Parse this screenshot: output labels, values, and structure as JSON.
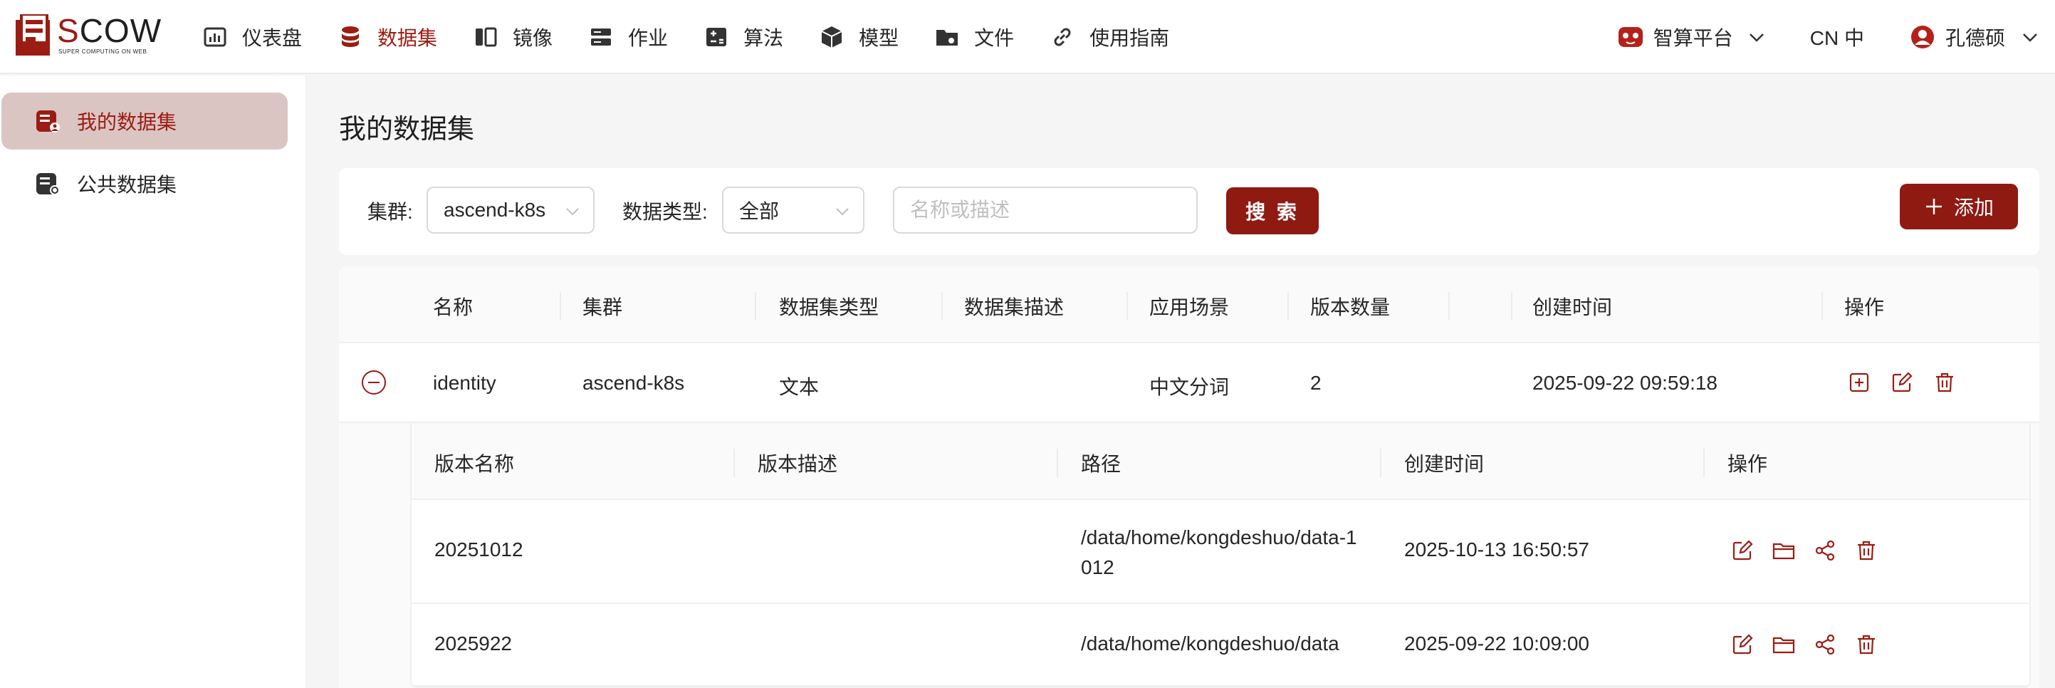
{
  "brand": {
    "name": "SCOW",
    "subtitle": "SUPER COMPUTING ON WEB",
    "accent": "#9b1c12"
  },
  "nav": [
    {
      "label": "仪表盘",
      "icon": "dashboard-icon"
    },
    {
      "label": "数据集",
      "icon": "database-icon",
      "active": true
    },
    {
      "label": "镜像",
      "icon": "image-icon"
    },
    {
      "label": "作业",
      "icon": "job-icon"
    },
    {
      "label": "算法",
      "icon": "algorithm-icon"
    },
    {
      "label": "模型",
      "icon": "model-cube-icon"
    },
    {
      "label": "文件",
      "icon": "folder-icon"
    },
    {
      "label": "使用指南",
      "icon": "link-icon"
    }
  ],
  "header_right": {
    "platform": "智算平台",
    "language": "CN 中",
    "user": "孔德硕"
  },
  "sidebar": [
    {
      "label": "我的数据集",
      "active": true
    },
    {
      "label": "公共数据集"
    }
  ],
  "page": {
    "title": "我的数据集"
  },
  "filters": {
    "cluster_label": "集群:",
    "cluster_value": "ascend-k8s",
    "type_label": "数据类型:",
    "type_value": "全部",
    "search_placeholder": "名称或描述",
    "search_button": "搜 索",
    "add_button": "添加"
  },
  "table": {
    "columns": [
      "名称",
      "集群",
      "数据集类型",
      "数据集描述",
      "应用场景",
      "版本数量",
      "创建时间",
      "操作"
    ],
    "rows": [
      {
        "name": "identity",
        "cluster": "ascend-k8s",
        "type": "文本",
        "description": "",
        "scenario": "中文分词",
        "versions": "2",
        "created": "2025-09-22 09:59:18"
      }
    ]
  },
  "versions_table": {
    "columns": [
      "版本名称",
      "版本描述",
      "路径",
      "创建时间",
      "操作"
    ],
    "rows": [
      {
        "name": "20251012",
        "description": "",
        "path": "/data/home/kongdeshuo/data-1012",
        "created": "2025-10-13 16:50:57"
      },
      {
        "name": "2025922",
        "description": "",
        "path": "/data/home/kongdeshuo/data",
        "created": "2025-09-22 10:09:00"
      }
    ]
  }
}
